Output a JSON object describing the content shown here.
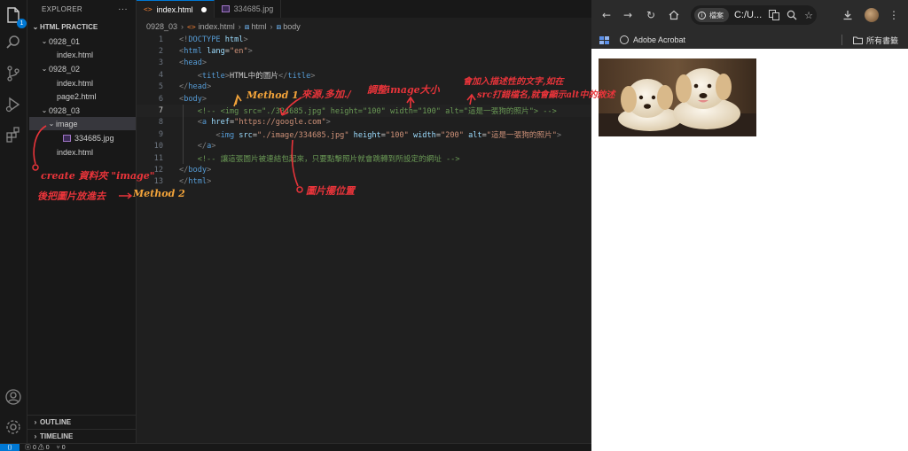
{
  "explorer": {
    "title": "EXPLORER",
    "more_label": "···",
    "badge": "1",
    "tree": [
      {
        "label": "HTML PRACTICE",
        "level": 0,
        "kind": "root"
      },
      {
        "label": "0928_01",
        "level": 1,
        "kind": "folder"
      },
      {
        "label": "index.html",
        "level": 2,
        "kind": "file"
      },
      {
        "label": "0928_02",
        "level": 1,
        "kind": "folder"
      },
      {
        "label": "index.html",
        "level": 2,
        "kind": "file"
      },
      {
        "label": "page2.html",
        "level": 2,
        "kind": "file"
      },
      {
        "label": "0928_03",
        "level": 1,
        "kind": "folder"
      },
      {
        "label": "image",
        "level": 2,
        "kind": "folder",
        "selected": true
      },
      {
        "label": "334685.jpg",
        "level": 3,
        "kind": "image"
      },
      {
        "label": "index.html",
        "level": 2,
        "kind": "file"
      }
    ],
    "outline": "OUTLINE",
    "timeline": "TIMELINE"
  },
  "editor": {
    "tabs": [
      {
        "label": "index.html",
        "active": true,
        "dirty": true
      },
      {
        "label": "334685.jpg",
        "active": false
      }
    ],
    "breadcrumb": [
      "0928_03",
      "index.html",
      "html",
      "body"
    ],
    "current_line": 7,
    "line_numbers": [
      "1",
      "2",
      "3",
      "4",
      "5",
      "6",
      "7",
      "8",
      "9",
      "10",
      "11",
      "12",
      "13"
    ],
    "lines": [
      "<!DOCTYPE html>",
      "<html lang=\"en\">",
      "<head>",
      "    <title>HTML中的圖片</title>",
      "</head>",
      "<body>",
      "    <!-- <img src=\"./334685.jpg\" height=\"100\" width=\"100\" alt=\"這是一張狗的照片\"> -->",
      "    <a href=\"https://google.com\">",
      "        <img src=\"./image/334685.jpg\" height=\"100\" width=\"200\" alt=\"這是一張狗的照片\">",
      "    </a>",
      "    <!-- 讓這張圖片被連結包起來，只要點擊照片就會跳轉到所設定的網址 -->",
      "</body>",
      "</html>"
    ]
  },
  "status_bar": {
    "errors": "ⓧ 0 ⚠ 0",
    "ports": "⑂ 0"
  },
  "annotations": {
    "method1": "Method 1",
    "source": "來源,多加./",
    "resize": "調整image大小",
    "alt_note_1": "會加入描述性的文字,如在",
    "alt_note_2": "src打錯檔名,就會顯示alt中的敘述",
    "location": "圖片擺位置",
    "create_folder": "create 資料夾 \"image\"",
    "move_image": "後把圖片放進去",
    "method2": "Method 2"
  },
  "browser": {
    "site_label": "檔案",
    "url": "C:/U...",
    "bookmarks": [
      {
        "label": "Adobe Acrobat"
      },
      {
        "label": "所有書籤"
      }
    ],
    "image_alt": "這是一張狗的照片"
  },
  "colors": {
    "accent": "#0078d4",
    "annotation_red": "#e8343a",
    "annotation_orange": "#f2a33a"
  }
}
